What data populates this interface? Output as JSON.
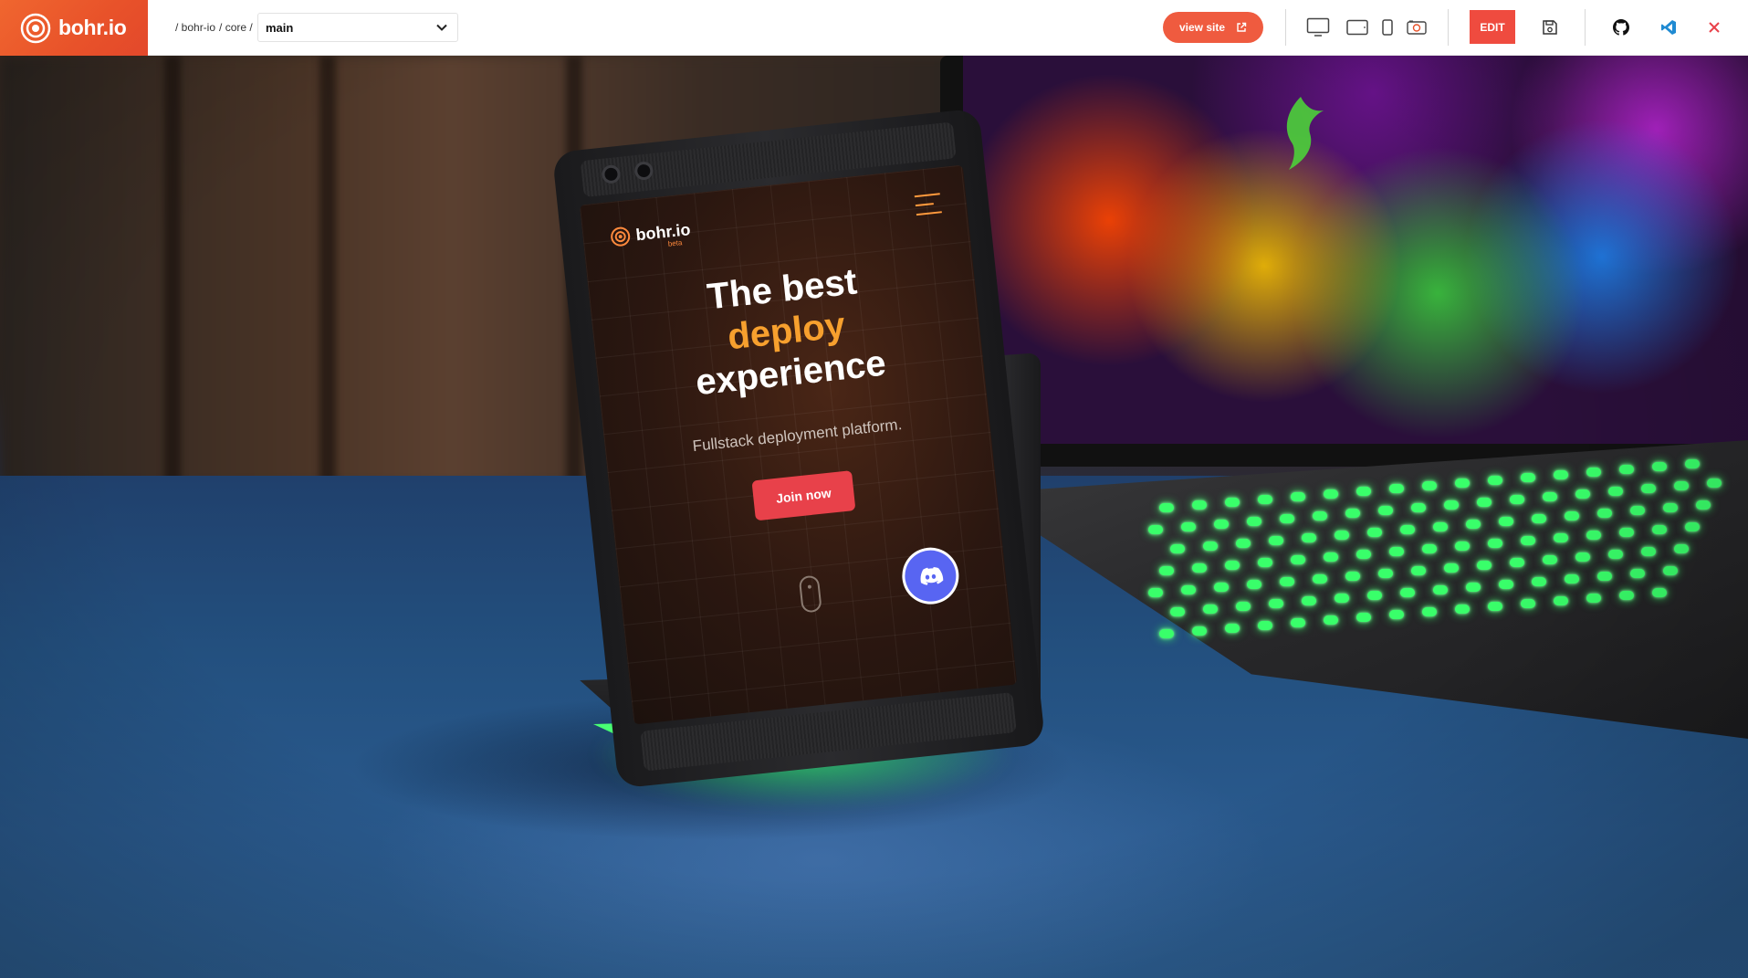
{
  "app": {
    "brand": "bohr.io",
    "brand_color": "#ef5b3f"
  },
  "breadcrumb": {
    "items": [
      "/ bohr-io",
      "/ core /"
    ]
  },
  "branch": {
    "value": "main",
    "icon": "chevron-down-icon"
  },
  "toolbar": {
    "view_site_label": "view site",
    "view_site_icon": "external-link-icon",
    "devices": [
      "desktop-icon",
      "tablet-icon",
      "mobile-icon",
      "screenshot-icon"
    ],
    "edit_label": "EDIT",
    "save_icon": "save-icon",
    "github_icon": "github-icon",
    "vscode_icon": "vscode-icon",
    "close_icon": "close-icon",
    "accent": "#ef4b3f"
  },
  "preview": {
    "site_brand": "bohr.io",
    "site_beta": "beta",
    "headline_line1": "The best",
    "headline_line2": "deploy",
    "headline_line3": "experience",
    "subtitle": "Fullstack deployment platform.",
    "cta": "Join now",
    "cta_color": "#e8414a",
    "accent": "#f7a02e",
    "discord_icon": "discord-icon"
  }
}
